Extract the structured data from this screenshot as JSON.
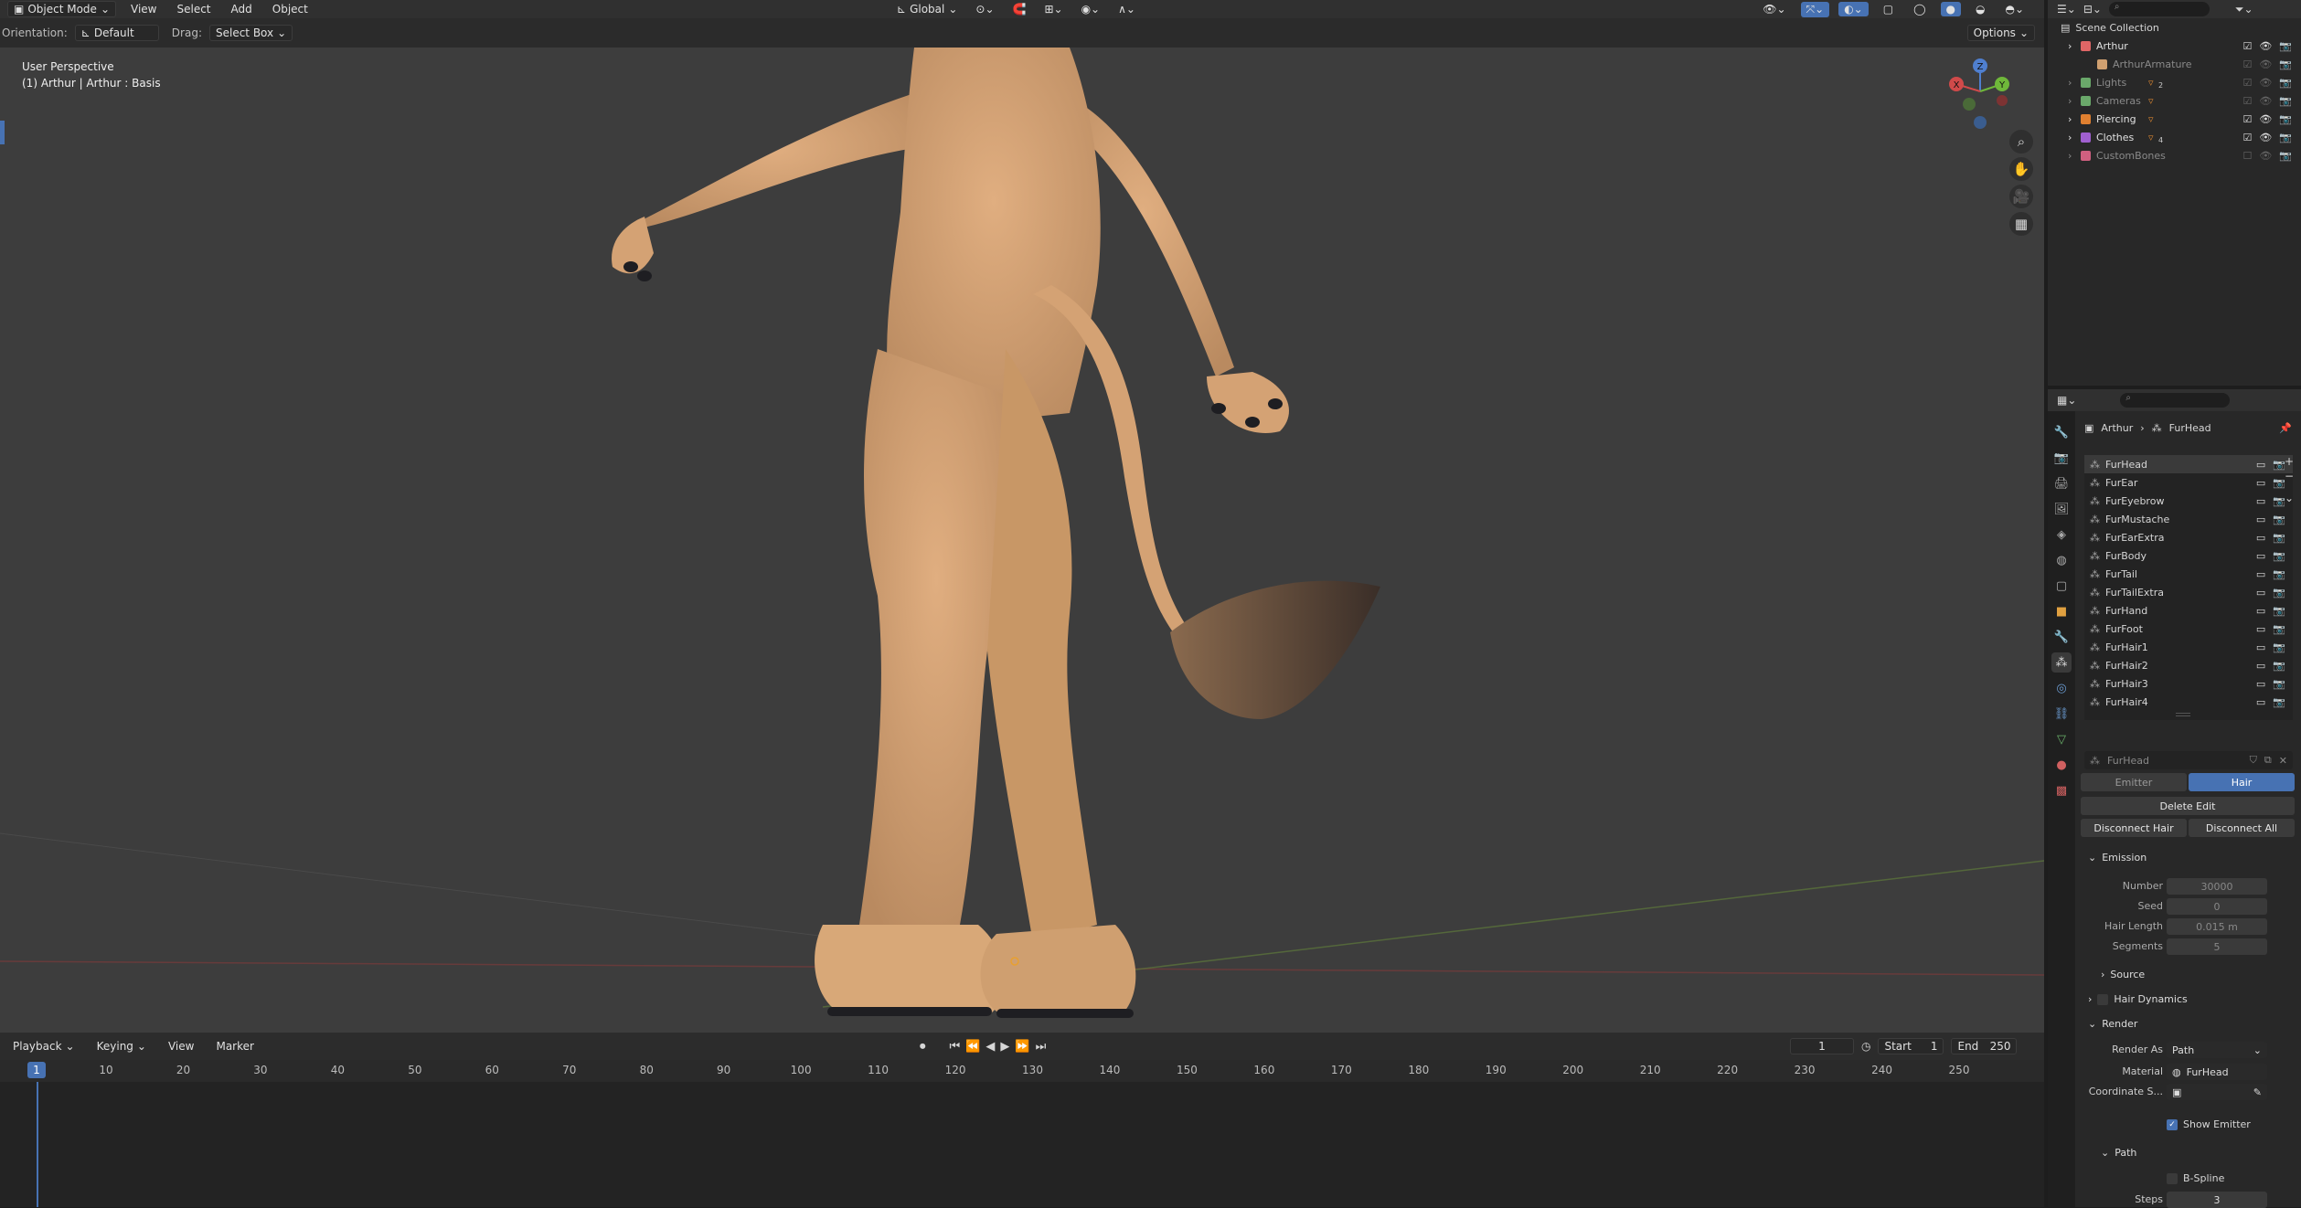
{
  "header": {
    "mode": "Object Mode",
    "menus": [
      "View",
      "Select",
      "Add",
      "Object"
    ],
    "transform_orientation": "Global"
  },
  "toolbar": {
    "orientation_label": "Orientation:",
    "orientation_value": "Default",
    "drag_label": "Drag:",
    "drag_value": "Select Box",
    "options_label": "Options"
  },
  "viewport": {
    "perspective": "User Perspective",
    "object_info": "(1) Arthur | Arthur : Basis",
    "gizmo_labels": [
      "X",
      "Y",
      "Z"
    ]
  },
  "outliner": {
    "root": "Scene Collection",
    "items": [
      {
        "label": "Arthur",
        "color": "#e06666",
        "child": false,
        "muted": false
      },
      {
        "label": "ArthurArmature",
        "color": "#d0a070",
        "child": true,
        "muted": true
      },
      {
        "label": "Lights",
        "color": "#6aa86a",
        "child": false,
        "muted": true
      },
      {
        "label": "Cameras",
        "color": "#6aa86a",
        "child": false,
        "muted": true
      },
      {
        "label": "Piercing",
        "color": "#e08030",
        "child": false,
        "muted": false
      },
      {
        "label": "Clothes",
        "color": "#a060d0",
        "child": false,
        "muted": false
      },
      {
        "label": "CustomBones",
        "color": "#d06080",
        "child": false,
        "muted": true
      }
    ],
    "badges": [
      "2",
      "4"
    ]
  },
  "properties": {
    "breadcrumb_object": "Arthur",
    "breadcrumb_system": "FurHead",
    "systems": [
      "FurHead",
      "FurEar",
      "FurEyebrow",
      "FurMustache",
      "FurEarExtra",
      "FurBody",
      "FurTail",
      "FurTailExtra",
      "FurHand",
      "FurFoot",
      "FurHair1",
      "FurHair2",
      "FurHair3",
      "FurHair4"
    ],
    "settings_name": "FurHead",
    "type_emitter": "Emitter",
    "type_hair": "Hair",
    "delete_edit": "Delete Edit",
    "disconnect_hair": "Disconnect Hair",
    "disconnect_all": "Disconnect All",
    "emission_title": "Emission",
    "number_label": "Number",
    "number_value": "30000",
    "seed_label": "Seed",
    "seed_value": "0",
    "hair_length_label": "Hair Length",
    "hair_length_value": "0.015 m",
    "segments_label": "Segments",
    "segments_value": "5",
    "source_title": "Source",
    "hair_dynamics_title": "Hair Dynamics",
    "render_title": "Render",
    "render_as_label": "Render As",
    "render_as_value": "Path",
    "material_label": "Material",
    "material_value": "FurHead",
    "coord_label": "Coordinate S...",
    "show_emitter_label": "Show Emitter",
    "path_title": "Path",
    "bspline_label": "B-Spline",
    "steps_label": "Steps",
    "steps_value": "3"
  },
  "timeline": {
    "menus": [
      "Playback",
      "Keying",
      "View",
      "Marker"
    ],
    "current_frame": "1",
    "start_label": "Start",
    "start_value": "1",
    "end_label": "End",
    "end_value": "250",
    "ruler_ticks": [
      "10",
      "20",
      "30",
      "40",
      "50",
      "60",
      "70",
      "80",
      "90",
      "100",
      "110",
      "120",
      "130",
      "140",
      "150",
      "160",
      "170",
      "180",
      "190",
      "200",
      "210",
      "220",
      "230",
      "240",
      "250"
    ],
    "playhead_label": "1"
  },
  "colors": {
    "accent": "#4772b3",
    "fur": "#d4a274",
    "viewport_bg": "#3d3d3d"
  }
}
